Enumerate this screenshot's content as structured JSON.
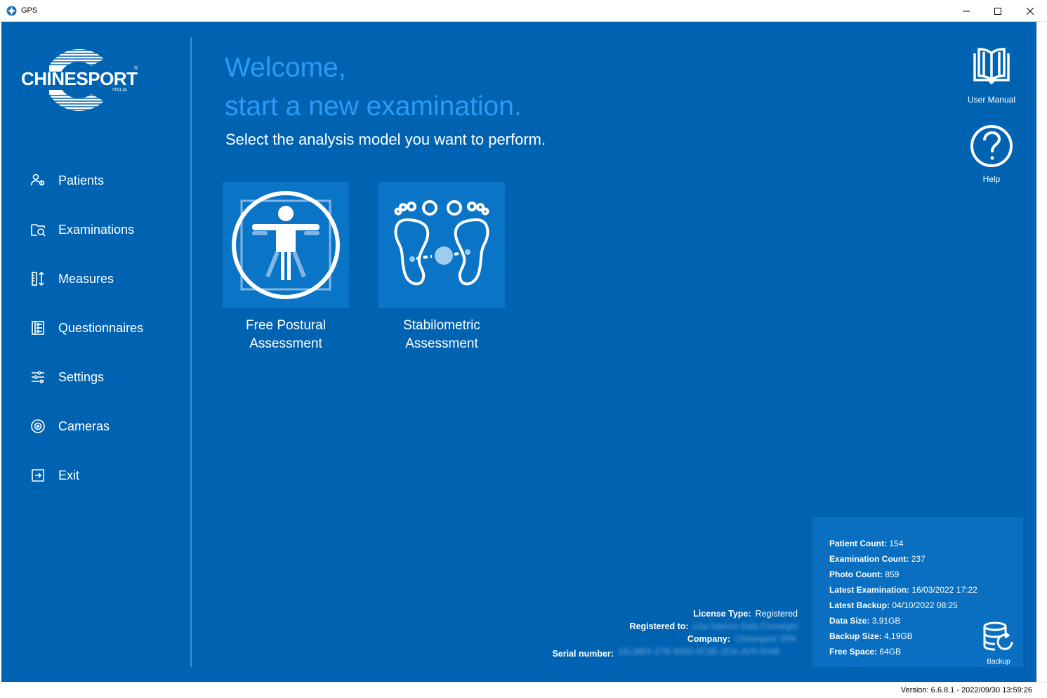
{
  "window": {
    "title": "GPS"
  },
  "logo": {
    "brand": "CHINESPORT",
    "sub": "ITALIA"
  },
  "nav": {
    "items": [
      {
        "label": "Patients",
        "icon": "patients-icon"
      },
      {
        "label": "Examinations",
        "icon": "examinations-icon"
      },
      {
        "label": "Measures",
        "icon": "measures-icon"
      },
      {
        "label": "Questionnaires",
        "icon": "questionnaires-icon"
      },
      {
        "label": "Settings",
        "icon": "settings-sliders-icon"
      },
      {
        "label": "Cameras",
        "icon": "camera-icon"
      },
      {
        "label": "Exit",
        "icon": "exit-icon"
      }
    ]
  },
  "main": {
    "welcome_line1": "Welcome,",
    "welcome_line2": "start a new examination.",
    "subtitle": "Select the analysis model you want to perform.",
    "tiles": [
      {
        "label": "Free Postural\nAssessment",
        "icon": "vitruvian-man-icon"
      },
      {
        "label": "Stabilometric\nAssessment",
        "icon": "footprints-icon"
      }
    ]
  },
  "right_buttons": {
    "manual": "User Manual",
    "help": "Help"
  },
  "stats": {
    "rows": [
      {
        "key": "Patient Count:",
        "value": "154"
      },
      {
        "key": "Examination Count:",
        "value": "237"
      },
      {
        "key": "Photo Count:",
        "value": "859"
      },
      {
        "key": "Latest Examination:",
        "value": "16/03/2022 17:22"
      },
      {
        "key": "Latest Backup:",
        "value": "04/10/2022 08:25"
      },
      {
        "key": "Data Size:",
        "value": "3,91GB"
      },
      {
        "key": "Backup Size:",
        "value": "4,19GB"
      },
      {
        "key": "Free Space:",
        "value": "64GB"
      }
    ],
    "backup_label": "Backup"
  },
  "license": {
    "type_key": "License Type:",
    "type_value": "Registered",
    "registered_key": "Registered to:",
    "registered_value": "Uso Interno Sala Convegni",
    "company_key": "Company:",
    "company_value": "Chinesport SPA",
    "serial_key": "Serial number:",
    "serial_value": "1ELMEF-27B-8400-0C0E-2DA-AV5-0048"
  },
  "status": {
    "version": "Version: 6.6.8.1 - 2022/09/30 13:59:26"
  },
  "colors": {
    "background": "#0063b2",
    "accent": "#2b9bf4",
    "tile": "#0a74c7"
  }
}
